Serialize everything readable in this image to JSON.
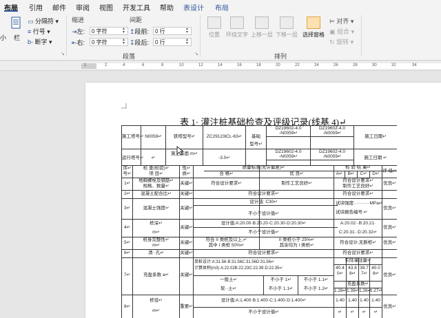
{
  "tabs": [
    "布局",
    "引用",
    "邮件",
    "审阅",
    "视图",
    "开发工具",
    "帮助",
    "表设计",
    "布局"
  ],
  "ribbon": {
    "left_partial": [
      "小",
      "栏"
    ],
    "columns_group": {
      "split": "分隔符",
      "line_numbers": "行号",
      "hyphenation": "断字"
    },
    "indent": {
      "label": "缩进",
      "left_label": "左:",
      "left_value": "0 字符",
      "right_label": "右:",
      "right_value": "0 字符"
    },
    "spacing": {
      "label": "间距",
      "before_label": "段前:",
      "before_value": "0 行",
      "after_label": "段后:",
      "after_value": "0 行"
    },
    "paragraph_group": "段落",
    "arrange": {
      "position": "位置",
      "wrap": "环绕文字",
      "forward": "上移一层",
      "backward": "下移一层",
      "selection_pane": "选择窗格",
      "align": "对齐",
      "group": "组合",
      "rotate": "旋转",
      "group_label": "排列"
    }
  },
  "ruler_ticks": [
    "1",
    "2",
    "4",
    "6",
    "8",
    "10",
    "12",
    "14",
    "16",
    "18",
    "20",
    "22",
    "24",
    "26",
    "28",
    "30",
    "32",
    "34"
  ],
  "doc": {
    "title": "表 1· 灌注桩基础检查及评级记录(线基 4)↵",
    "r1": {
      "a": "施工塔号↵",
      "b": "N0059↵",
      "c": "铁塔型号↵",
      "d": "ZC29123lCL-63↵",
      "e": "基础",
      "f": "DZ19602-4.0",
      "g": "DZ19602-4.0",
      "h": "施工日期↵"
    },
    "r1b": {
      "f": "-N0059↵",
      "g": "-N0059↵"
    },
    "r2": {
      "a": "运行塔号↵",
      "b": "↵",
      "c": "施工基面 m↵",
      "d": "-3.0↵",
      "e": "型号↵",
      "f": "DZ19602-4.0",
      "g": "DZ19602-4.0",
      "h": "施工日期 ↵"
    },
    "r2b": {
      "f": "-N0059↵",
      "g": "-N0059↵"
    },
    "hdr": {
      "seq": "序↵",
      "seq2": "号↵",
      "item": "检 查(检验)↵",
      "item2": "项   目↵",
      "nature": "性↵",
      "nature2": "质↵",
      "std": "质量标准(允许偏差)↵",
      "std_ok": "合 格↵",
      "std_good": "优 良↵",
      "result": "检 验 结 果↵",
      "ra": "A↵",
      "rb": "B↵",
      "rc": "C↵",
      "rd": "D↵",
      "grade": "评 级↵"
    },
    "rows": [
      {
        "n": "1↵",
        "item": "地脚螺栓及钢筋↵",
        "item2": "规格、数量↵",
        "nat": "关键↵",
        "ok": "符合设计要求↵",
        "good": "制作工艺良好↵",
        "res": "符合设计要求↵",
        "res2": "制作工艺良好↵",
        "g": "优良↵"
      },
      {
        "n": "2↵",
        "item": "混凝土配合比↵",
        "nat": "关键↵",
        "ok": "符合设计要求↵",
        "res": "符合设计要求↵"
      },
      {
        "n": "3↵",
        "item": "混凝土强度↵",
        "nat": "关键↵",
        "ok": "设计值: C30↵",
        "ok2": "不小于设计值↵",
        "res": "试块强度:··········MPa↵",
        "res2": "试块报告编号:↵",
        "g": "优良↵"
      },
      {
        "n": "4↵",
        "item": "桩深↵",
        "item2": "m↵",
        "nat": "关键↵",
        "ok": "设计值:A:20.00·B:20.20·C:20.30·D:20.30↵",
        "ok2": "不小于设计值↵",
        "res": "A:20.02··B:20.21·",
        "res2": "C:20.31··D:20.32↵",
        "g": "优良↵"
      },
      {
        "n": "5↵",
        "item": "桩身完整性↵",
        "item2": "m↵",
        "nat": "关键↵",
        "ok": "符合 II 类桩及以上,↵",
        "ok2": "其中 I 类桩 50%↵",
        "good": "II 类桩小于 25%↵",
        "good2": "其余均为 I 类桩↵",
        "res": "符合设计,无断桩↵",
        "g": "优良↵"
      },
      {
        "n": "6↵",
        "item": "清··孔↵",
        "nat": "关键↵",
        "ok": "符合设计要求↵",
        "res": "符合设计要求↵"
      },
      {
        "n": "7↵",
        "item": "充盈系数 a↵",
        "nat": "关键↵",
        "ok": "单桩设计:A:31.56·B:31.56C:31.56D:31.56↵",
        "ok2": "计算体积(m3) A:22.02B:22.23C:22.39·D:22.35↵",
        "fill": "实际灌注量↵",
        "fv": [
          "40.4",
          "43.8",
          "39.7",
          "40.0"
        ],
        "fv2": [
          "0↵",
          "8↵",
          "7↵",
          "8↵"
        ],
        "soil": "一般土↵",
        "soil_ok": "不小于 1↵",
        "soil_good": "不小于 1.1↵",
        "soft": "软··土↵",
        "soft_ok": "不小于 1.1↵",
        "soft_good": "不小于 1.2↵",
        "coef": "充盈系数↵",
        "cv": [
          "1.28↵",
          "1.39↵",
          "1.26↵",
          "1.27↵"
        ],
        "g": "优良↵"
      },
      {
        "n": "8↵",
        "item": "桩径↵",
        "item2": "m↵",
        "nat": "重要↵",
        "ok": "设计值:A:1.400·B:1.400·C:1.400·D:1.400↵",
        "ok2": "不小于设计值↵",
        "res": [
          "1.40",
          "1.40",
          "1.40",
          "1.40"
        ],
        "res2": [
          "↵",
          "↵",
          "↵",
          "↵"
        ],
        "g": "优良↵"
      }
    ]
  }
}
